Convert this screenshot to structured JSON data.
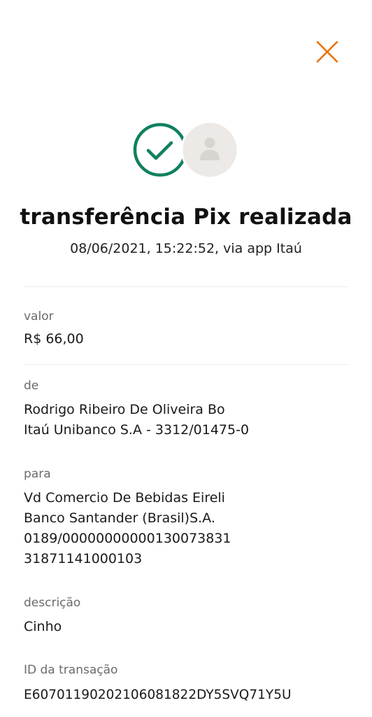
{
  "header": {
    "close_icon": "close-icon",
    "accent_color": "#EC7000"
  },
  "status": {
    "success_icon": "check-circle-icon",
    "success_color": "#108060",
    "avatar_icon": "person-icon",
    "title": "transferência Pix realizada",
    "subtitle": "08/06/2021, 15:22:52, via app Itaú"
  },
  "details": {
    "valor": {
      "label": "valor",
      "value": "R$ 66,00"
    },
    "de": {
      "label": "de",
      "name": "Rodrigo Ribeiro De Oliveira Bo",
      "bank": "Itaú Unibanco S.A - 3312/01475-0"
    },
    "para": {
      "label": "para",
      "name": "Vd Comercio De Bebidas Eireli",
      "bank": "Banco Santander (Brasil)S.A.",
      "account": "0189/00000000000130073831",
      "document": "31871141000103"
    },
    "descricao": {
      "label": "descrição",
      "value": "Cinho"
    },
    "id_transacao": {
      "label": "ID da transação",
      "value": "E60701190202106081822DY5SVQ71Y5U"
    }
  }
}
